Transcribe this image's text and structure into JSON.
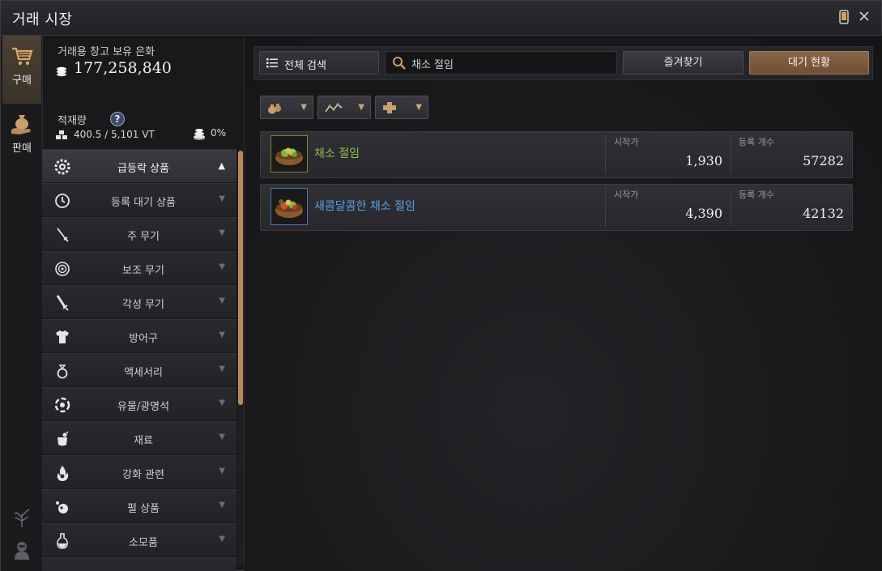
{
  "window": {
    "title": "거래 시장"
  },
  "modes": [
    {
      "label": "구매",
      "icon": "cart-icon",
      "active": true
    },
    {
      "label": "판매",
      "icon": "money-bag-icon",
      "active": false
    }
  ],
  "wallet": {
    "label": "거래용 창고 보유 은화",
    "amount": "177,258,840"
  },
  "weight": {
    "label": "적재량",
    "help": "?",
    "value": "400.5 / 5,101 VT",
    "percent": "0%"
  },
  "categories": [
    {
      "label": "급등락 상품",
      "icon": "gear-star-icon",
      "arrow": "▲",
      "selected": true
    },
    {
      "label": "등록 대기 상품",
      "icon": "clock-icon",
      "arrow": "▼"
    },
    {
      "label": "주 무기",
      "icon": "sword-icon",
      "arrow": "▼"
    },
    {
      "label": "보조 무기",
      "icon": "shield-icon",
      "arrow": "▼"
    },
    {
      "label": "각성 무기",
      "icon": "great-sword-icon",
      "arrow": "▼"
    },
    {
      "label": "방어구",
      "icon": "armor-icon",
      "arrow": "▼"
    },
    {
      "label": "액세서리",
      "icon": "ring-icon",
      "arrow": "▼"
    },
    {
      "label": "유물/광명석",
      "icon": "relic-icon",
      "arrow": "▼"
    },
    {
      "label": "재료",
      "icon": "material-icon",
      "arrow": "▼"
    },
    {
      "label": "강화 관련",
      "icon": "flame-icon",
      "arrow": "▼"
    },
    {
      "label": "펄 상품",
      "icon": "pearl-icon",
      "arrow": "▼"
    },
    {
      "label": "소모품",
      "icon": "potion-icon",
      "arrow": "▼"
    }
  ],
  "toolbar": {
    "all_search_label": "전체 검색",
    "search_value": "채소 절임",
    "favorites_label": "즐겨찾기",
    "waiting_label": "대기 현황"
  },
  "filters": [
    {
      "icon": "bag-icon",
      "arrow": "▼"
    },
    {
      "icon": "trend-line-icon",
      "arrow": "▼"
    },
    {
      "icon": "cross-icon",
      "arrow": "▼"
    }
  ],
  "table": {
    "price_header": "시작가",
    "count_header": "등록 개수",
    "rows": [
      {
        "name": "채소 절임",
        "name_color": "#8cc14a",
        "price": "1,930",
        "count": "57282"
      },
      {
        "name": "새콤달콤한 채소 절임",
        "name_color": "#5aa0e6",
        "price": "4,390",
        "count": "42132"
      }
    ]
  },
  "colors": {
    "accent": "#b88a5a",
    "grade_green": "#8cc14a",
    "grade_blue": "#5aa0e6"
  }
}
